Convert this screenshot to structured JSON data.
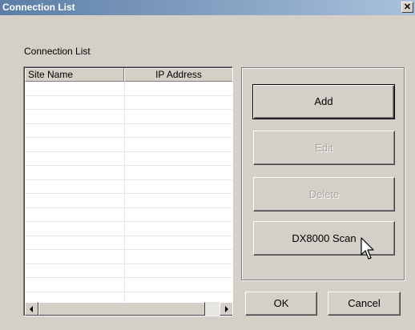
{
  "window": {
    "title": "Connection List",
    "close_glyph": "✕"
  },
  "group_label": "Connection List",
  "table": {
    "columns": [
      "Site Name",
      "IP Address"
    ],
    "rows": [
      [
        "",
        ""
      ],
      [
        "",
        ""
      ],
      [
        "",
        ""
      ],
      [
        "",
        ""
      ],
      [
        "",
        ""
      ],
      [
        "",
        ""
      ],
      [
        "",
        ""
      ],
      [
        "",
        ""
      ],
      [
        "",
        ""
      ],
      [
        "",
        ""
      ],
      [
        "",
        ""
      ],
      [
        "",
        ""
      ],
      [
        "",
        ""
      ],
      [
        "",
        ""
      ],
      [
        "",
        ""
      ],
      [
        "",
        ""
      ]
    ]
  },
  "buttons": {
    "add": "Add",
    "edit": "Edit",
    "delete": "Delete",
    "scan": "DX8000 Scan",
    "ok": "OK",
    "cancel": "Cancel"
  },
  "icons": {
    "close": "close-icon",
    "scroll_left": "chevron-left-icon",
    "scroll_right": "chevron-right-icon",
    "cursor": "mouse-pointer-icon"
  },
  "colors": {
    "titlebar_start": "#5c7ea6",
    "titlebar_end": "#a9c1dc",
    "face": "#d4d0c8",
    "disabled_text": "#a6a39b"
  }
}
